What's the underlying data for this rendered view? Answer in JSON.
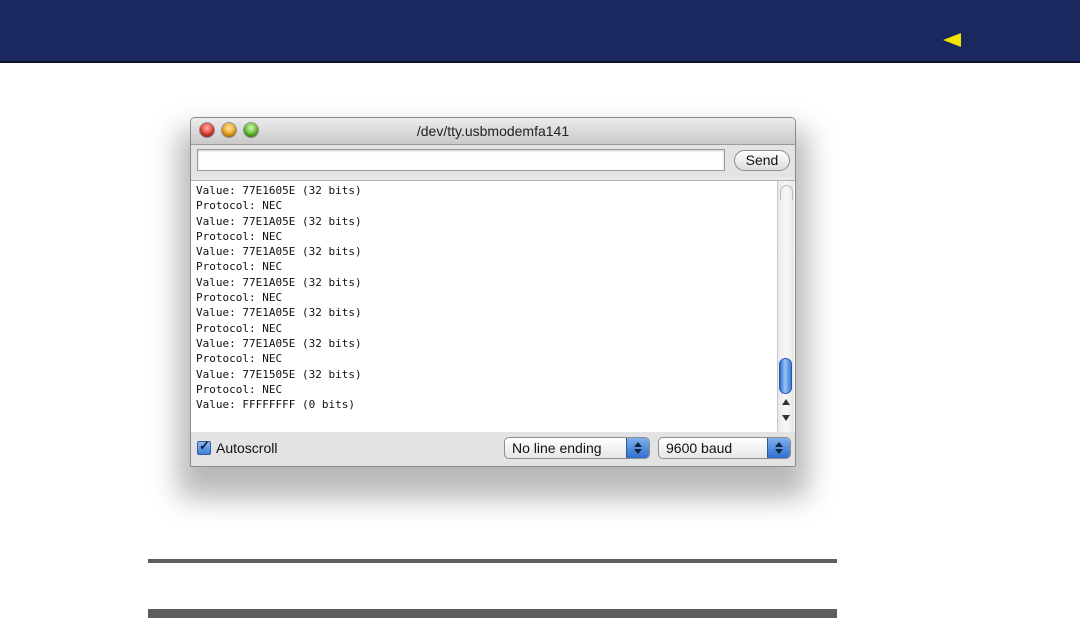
{
  "window": {
    "title": "/dev/tty.usbmodemfa141"
  },
  "input": {
    "value": "",
    "placeholder": ""
  },
  "toolbar": {
    "send_label": "Send"
  },
  "console": {
    "lines": [
      "Value: 77E1605E (32 bits)",
      "Protocol: NEC",
      "Value: 77E1A05E (32 bits)",
      "Protocol: NEC",
      "Value: 77E1A05E (32 bits)",
      "Protocol: NEC",
      "Value: 77E1A05E (32 bits)",
      "Protocol: NEC",
      "Value: 77E1A05E (32 bits)",
      "Protocol: NEC",
      "Value: 77E1A05E (32 bits)",
      "Protocol: NEC",
      "Value: 77E1505E (32 bits)",
      "Protocol: NEC",
      "Value: FFFFFFFF (0 bits)"
    ]
  },
  "footer": {
    "autoscroll_label": "Autoscroll",
    "autoscroll_checked": true,
    "line_ending": "No line ending",
    "baud": "9600 baud"
  },
  "colors": {
    "header_bg": "#1b2860",
    "back_arrow": "#f3e100",
    "accent_blue": "#3f7fd8"
  },
  "icons": {
    "back": "left-triangle-icon"
  }
}
